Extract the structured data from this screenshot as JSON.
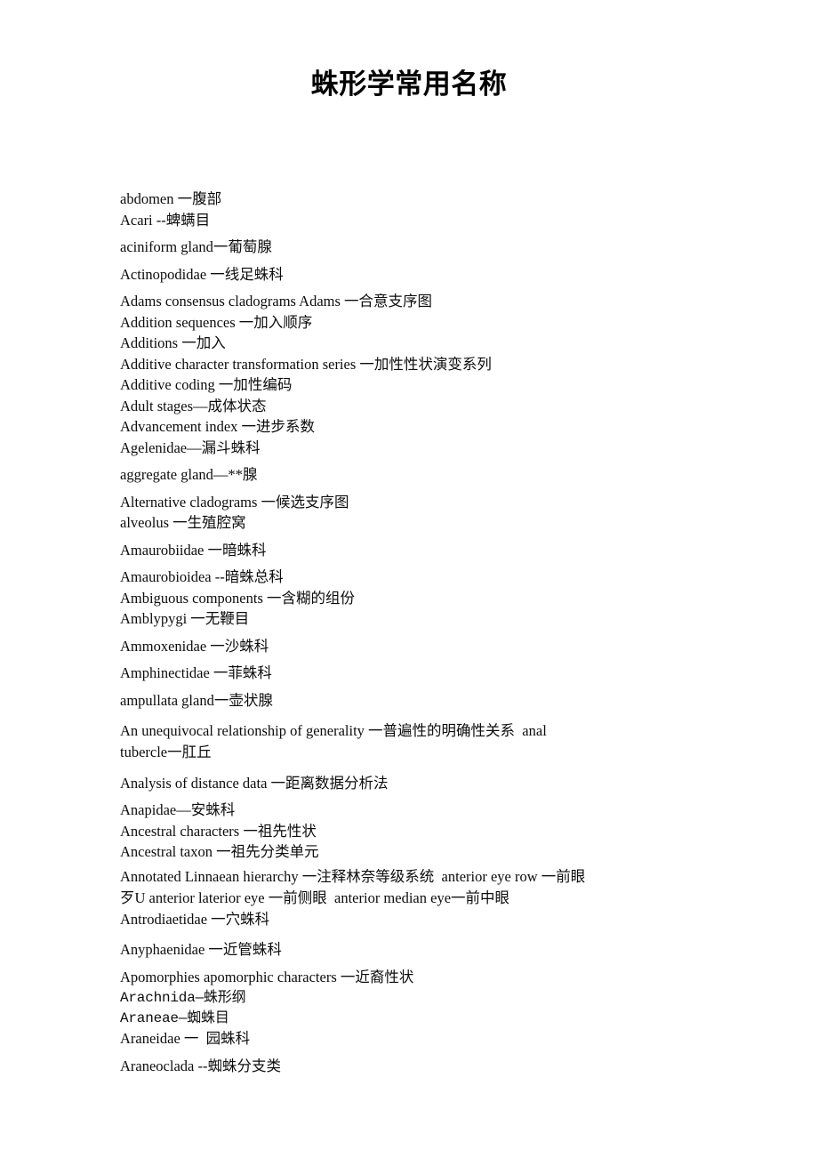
{
  "document": {
    "title": "蛛形学常用名称",
    "page_background": "#ffffff",
    "text_color": "#000000"
  },
  "glossary": {
    "entries": [
      {
        "text": "abdomen 一腹部",
        "spacing": "tight",
        "style": "serif"
      },
      {
        "text": "Acari --蜱螨目",
        "spacing": "loose",
        "style": "serif"
      },
      {
        "text": "aciniform gland一葡萄腺",
        "spacing": "loose",
        "style": "serif"
      },
      {
        "text": "Actinopodidae 一线足蛛科",
        "spacing": "loose",
        "style": "serif"
      },
      {
        "text": "Adams consensus cladograms Adams 一合意支序图",
        "spacing": "tight",
        "style": "serif"
      },
      {
        "text": "Addition sequences 一加入顺序",
        "spacing": "tight",
        "style": "serif"
      },
      {
        "text": "Additions 一加入",
        "spacing": "tight",
        "style": "serif"
      },
      {
        "text": "Additive character transformation series 一加性性状演变系列",
        "spacing": "tight",
        "style": "serif"
      },
      {
        "text": "Additive coding 一加性编码",
        "spacing": "tight",
        "style": "serif"
      },
      {
        "text": "Adult stages—成体状态",
        "spacing": "tight",
        "style": "serif"
      },
      {
        "text": "Advancement index 一进步系数",
        "spacing": "tight",
        "style": "serif"
      },
      {
        "text": "Agelenidae—漏斗蛛科",
        "spacing": "loose",
        "style": "serif"
      },
      {
        "text": "aggregate gland—**腺",
        "spacing": "loose",
        "style": "serif"
      },
      {
        "text": "Alternative cladograms 一候选支序图",
        "spacing": "tight",
        "style": "serif"
      },
      {
        "text": "alveolus 一生殖腔窝",
        "spacing": "loose",
        "style": "serif"
      },
      {
        "text": "Amaurobiidae 一暗蛛科",
        "spacing": "loose",
        "style": "serif"
      },
      {
        "text": "Amaurobioidea --暗蛛总科",
        "spacing": "tight",
        "style": "serif"
      },
      {
        "text": "Ambiguous components 一含糊的组份",
        "spacing": "tight",
        "style": "serif"
      },
      {
        "text": "Amblypygi 一无鞭目",
        "spacing": "loose",
        "style": "serif"
      },
      {
        "text": "Ammoxenidae 一沙蛛科",
        "spacing": "loose",
        "style": "serif"
      },
      {
        "text": "Amphinectidae 一菲蛛科",
        "spacing": "loose",
        "style": "serif"
      },
      {
        "text": "ampullata gland一壶状腺",
        "spacing": "loose",
        "style": "serif"
      },
      {
        "text": "An unequivocal relationship of generality 一普遍性的明确性关系  anal tubercle一肛丘",
        "spacing": "loose",
        "style": "serif",
        "wrap": true
      },
      {
        "text": "Analysis of distance data 一距离数据分析法",
        "spacing": "loose",
        "style": "serif"
      },
      {
        "text": "Anapidae—安蛛科",
        "spacing": "tight",
        "style": "serif"
      },
      {
        "text": "Ancestral characters 一祖先性状",
        "spacing": "tight",
        "style": "serif"
      },
      {
        "text": "Ancestral taxon 一祖先分类单元",
        "spacing": "tight",
        "style": "serif"
      },
      {
        "text": "Annotated Linnaean hierarchy 一注释林奈等级系统  anterior eye row 一前眼歹U anterior laterior eye 一前侧眼  anterior median eye一前中眼  Antrodiaetidae 一穴蛛科",
        "spacing": "loose",
        "style": "serif",
        "wrap": true
      },
      {
        "text": "Anyphaenidae 一近管蛛科",
        "spacing": "loose",
        "style": "serif"
      },
      {
        "text": "Apomorphies apomorphic characters 一近裔性状",
        "spacing": "tight",
        "style": "serif"
      },
      {
        "text": "Arachnida—蛛形纲",
        "spacing": "tight",
        "style": "mono"
      },
      {
        "text": "Araneae—蜘蛛目",
        "spacing": "tight",
        "style": "mono"
      },
      {
        "text": "Araneidae 一  园蛛科",
        "spacing": "loose",
        "style": "serif"
      },
      {
        "text": "Araneoclada --蜘蛛分支类",
        "spacing": "loose",
        "style": "serif"
      }
    ]
  }
}
